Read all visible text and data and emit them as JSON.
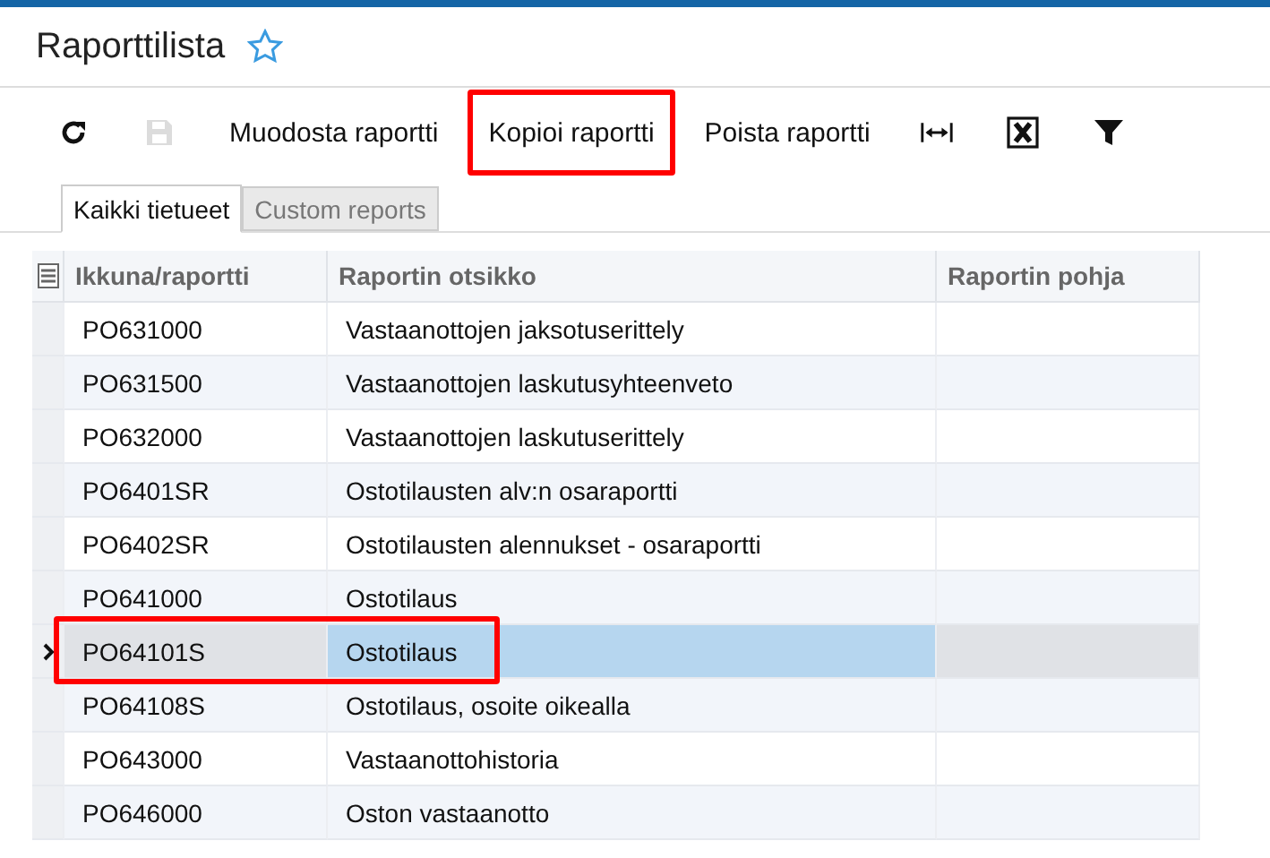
{
  "page": {
    "title": "Raporttilista",
    "favorite": false
  },
  "toolbar": [
    {
      "kind": "refresh",
      "disabled": false,
      "highlighted": false
    },
    {
      "kind": "save",
      "disabled": true,
      "highlighted": false
    },
    {
      "kind": "text",
      "label": "Muodosta raportti",
      "disabled": false,
      "highlighted": false
    },
    {
      "kind": "text",
      "label": "Kopioi raportti",
      "disabled": false,
      "highlighted": true
    },
    {
      "kind": "text",
      "label": "Poista raportti",
      "disabled": false,
      "highlighted": false
    },
    {
      "kind": "fit",
      "disabled": false,
      "highlighted": false
    },
    {
      "kind": "excel",
      "disabled": false,
      "highlighted": false
    },
    {
      "kind": "filter",
      "disabled": false,
      "highlighted": false
    }
  ],
  "tabs": [
    {
      "label": "Kaikki tietueet",
      "selected": true
    },
    {
      "label": "Custom reports",
      "selected": false
    }
  ],
  "table": {
    "columns": [
      "Ikkuna/raportti",
      "Raportin otsikko",
      "Raportin pohja"
    ],
    "rows": [
      {
        "id": "PO631000",
        "title": "Vastaanottojen jaksotuserittely",
        "selected": false,
        "highlighted": false
      },
      {
        "id": "PO631500",
        "title": "Vastaanottojen laskutusyhteenveto",
        "selected": false,
        "highlighted": false
      },
      {
        "id": "PO632000",
        "title": "Vastaanottojen laskutuserittely",
        "selected": false,
        "highlighted": false
      },
      {
        "id": "PO6401SR",
        "title": "Ostotilausten alv:n osaraportti",
        "selected": false,
        "highlighted": false
      },
      {
        "id": "PO6402SR",
        "title": "Ostotilausten alennukset - osaraportti",
        "selected": false,
        "highlighted": false
      },
      {
        "id": "PO641000",
        "title": "Ostotilaus",
        "selected": false,
        "highlighted": false
      },
      {
        "id": "PO64101S",
        "title": "Ostotilaus",
        "selected": true,
        "highlighted": true
      },
      {
        "id": "PO64108S",
        "title": "Ostotilaus, osoite oikealla",
        "selected": false,
        "highlighted": false
      },
      {
        "id": "PO643000",
        "title": "Vastaanottohistoria",
        "selected": false,
        "highlighted": false
      },
      {
        "id": "PO646000",
        "title": "Oston vastaanotto",
        "selected": false,
        "highlighted": false
      }
    ]
  }
}
